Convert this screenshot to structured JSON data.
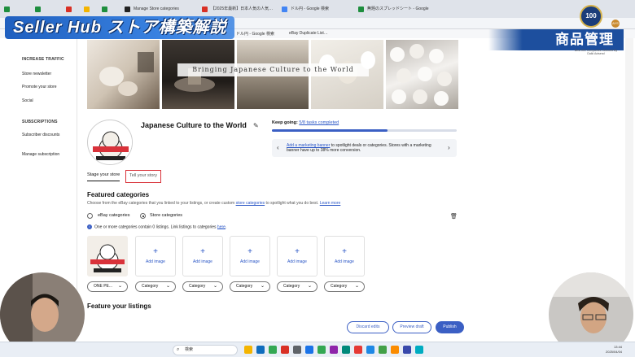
{
  "overlay": {
    "title": "Seller Hub ストア構築解説",
    "section": "商品管理",
    "medal_text": "100",
    "medal_caption": "Best 500 Companies Selected By Daiki Actsend"
  },
  "browser": {
    "tabs": [
      {
        "label": "",
        "color": "#1e8e3e"
      },
      {
        "label": "",
        "color": "#1e8e3e"
      },
      {
        "label": "",
        "color": "#d93025"
      },
      {
        "label": "",
        "color": "#f4b400"
      },
      {
        "label": "",
        "color": "#1e8e3e"
      },
      {
        "label": "Manage Store categories",
        "color": "#222222"
      },
      {
        "label": "【2025年最新】日本人気の人気…",
        "color": "#d93025"
      },
      {
        "label": "ドル円 - Google 検索",
        "color": "#4285f4"
      },
      {
        "label": "無題のスプレッドシート - Google",
        "color": "#1e8e3e"
      }
    ],
    "bookmarks": [
      "ドル円 - Google 検索",
      "eBay Duplicate List…"
    ],
    "avatar": "AYS"
  },
  "sidebar": {
    "group1_title": "INCREASE TRAFFIC",
    "group1_items": [
      "Store newsletter",
      "Promote your store",
      "Social"
    ],
    "group2_title": "SUBSCRIPTIONS",
    "group2_items": [
      "Subscriber discounts",
      "Manage subscription"
    ]
  },
  "hero": {
    "caption": "Bringing Japanese Culture to the World"
  },
  "store": {
    "name": "Japanese Culture to the World",
    "logo_top": "JAPANESE",
    "logo_mid": "CULTURE",
    "logo_bottom": "TO THE WORLD"
  },
  "progress": {
    "lead": "Keep going:",
    "link": "5/8 tasks completed",
    "fraction": 0.625
  },
  "tip": {
    "link": "Add a marketing banner",
    "text": " to spotlight deals or categories. Stores with a marketing banner have up to 38% more conversion."
  },
  "page_tabs": {
    "stage": "Stage your store",
    "story": "Tell your story"
  },
  "featured": {
    "heading": "Featured categories",
    "desc_pre": "Choose from the eBay categories that you linked to your listings, or create custom ",
    "desc_link": "store categories",
    "desc_post": " to spotlight what you do best. ",
    "learn_more": "Learn more",
    "radio_ebay": "eBay categories",
    "radio_store": "Store categories",
    "info_text": "One or more categories contain 0 listings. Link listings to categories ",
    "info_link": "here",
    "add_image": "Add image",
    "plus": "+",
    "selects": [
      "ONE PE...",
      "Category",
      "Category",
      "Category",
      "Category",
      "Category"
    ]
  },
  "feature_listings": {
    "heading": "Feature your listings"
  },
  "actions": {
    "discard": "Discard edits",
    "preview": "Preview draft",
    "publish": "Publish"
  },
  "taskbar": {
    "search": "検索",
    "time": "13:44",
    "date": "2025/04/04"
  },
  "colors": {
    "accent": "#3b5fc4",
    "highlight": "#d9323a",
    "banner": "#1f5fbf"
  }
}
